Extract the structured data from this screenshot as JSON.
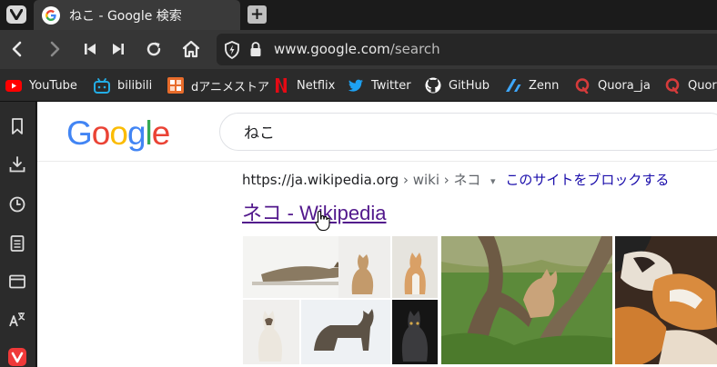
{
  "tab": {
    "title": "ねこ - Google 検索",
    "new_tab_symbol": "+"
  },
  "address": {
    "host": "www.google.com",
    "path": "/search"
  },
  "bookmarks": [
    {
      "label": "YouTube",
      "icon": "youtube-icon",
      "color": "#ff0000"
    },
    {
      "label": "bilibili",
      "icon": "bilibili-icon",
      "color": "#23ade5"
    },
    {
      "label": "dアニメストア",
      "icon": "danime-icon",
      "color": "#e86c2b"
    },
    {
      "label": "Netflix",
      "icon": "netflix-icon",
      "color": "#e50914"
    },
    {
      "label": "Twitter",
      "icon": "twitter-icon",
      "color": "#1da1f2"
    },
    {
      "label": "GitHub",
      "icon": "github-icon",
      "color": "#ffffff"
    },
    {
      "label": "Zenn",
      "icon": "zenn-icon",
      "color": "#3ea8ff"
    },
    {
      "label": "Quora_ja",
      "icon": "quora-icon",
      "color": "#d63b3b"
    },
    {
      "label": "Quor",
      "icon": "quora-icon",
      "color": "#d63b3b"
    }
  ],
  "google": {
    "logo_letters": [
      {
        "ch": "G",
        "color": "#4285f4"
      },
      {
        "ch": "o",
        "color": "#ea4335"
      },
      {
        "ch": "o",
        "color": "#fbbc05"
      },
      {
        "ch": "g",
        "color": "#4285f4"
      },
      {
        "ch": "l",
        "color": "#34a853"
      },
      {
        "ch": "e",
        "color": "#ea4335"
      }
    ],
    "query": "ねこ"
  },
  "result": {
    "site_url": "https://ja.wikipedia.org",
    "path": "› wiki › ネコ",
    "caret": "▾",
    "block_site": "このサイトをブロックする",
    "title": "ネコ - Wikipedia"
  },
  "colors": {
    "link_visited": "#52188c",
    "link_blue": "#1a0dab",
    "vivaldi_red": "#ef3939"
  }
}
